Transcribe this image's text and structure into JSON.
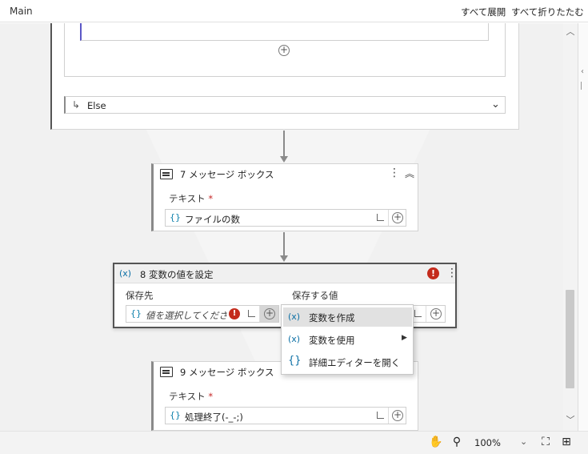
{
  "topbar": {
    "title": "Main",
    "expand_all": "すべて展開",
    "collapse_all": "すべて折りたたむ"
  },
  "if_block": {
    "else_label": "Else"
  },
  "card7": {
    "title": "7 メッセージ ボックス",
    "field_label": "テキスト",
    "required_mark": "*",
    "field_value": "ファイルの数"
  },
  "card8": {
    "title": "8 変数の値を設定",
    "left_label": "保存先",
    "right_label": "保存する値",
    "left_placeholder": "値を選択してください。"
  },
  "card9": {
    "title": "9 メッセージ ボックス",
    "field_label": "テキスト",
    "required_mark": "*",
    "field_value": "処理終了(-_-;)"
  },
  "context_menu": {
    "items": [
      {
        "label": "変数を作成",
        "icon": "variable-icon",
        "highlighted": true
      },
      {
        "label": "変数を使用",
        "icon": "variable-icon",
        "has_submenu": true
      },
      {
        "label": "詳細エディターを開く",
        "icon": "braces-icon"
      }
    ]
  },
  "icons": {
    "variable_glyph": "(x)",
    "braces_glyph": "{}",
    "error_glyph": "!",
    "plus_glyph": "+",
    "kebab_glyph": "⋮",
    "collapse_glyph": "︽",
    "submenu_glyph": "▶"
  },
  "bottombar": {
    "zoom": "100%"
  },
  "colors": {
    "accent_purple": "#5b57c6",
    "error_red": "#c42b1c",
    "variable_blue": "#0b6fa5"
  }
}
